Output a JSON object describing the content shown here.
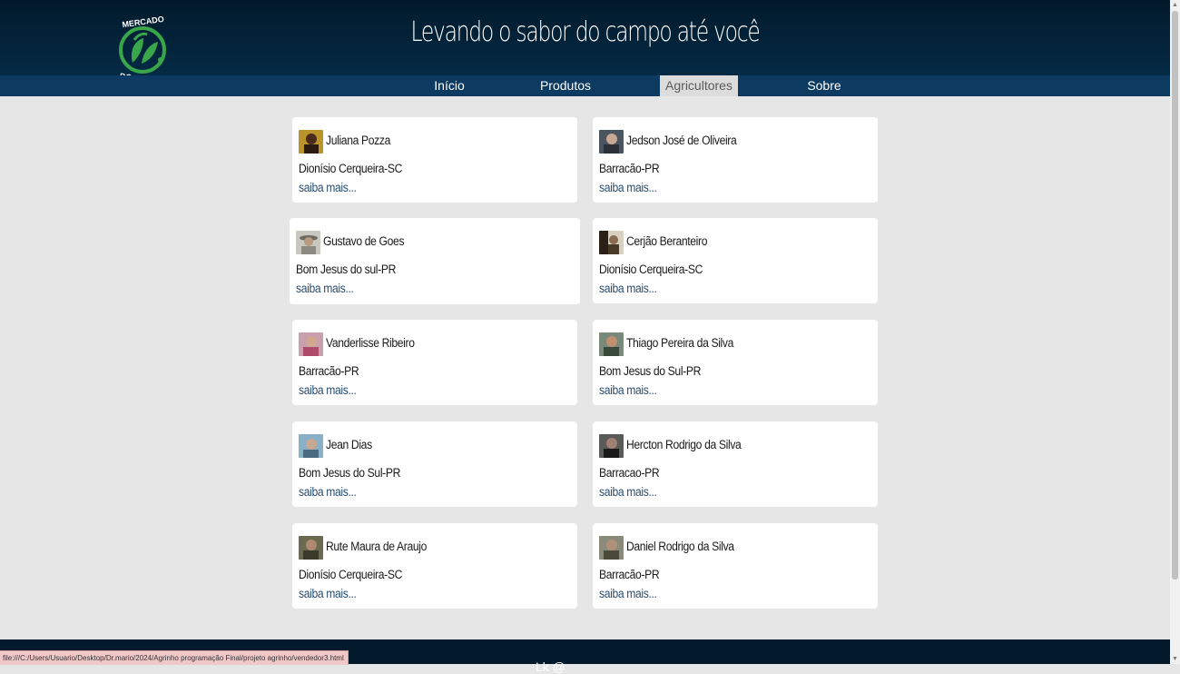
{
  "header": {
    "logo_top_text": "MERCADO",
    "logo_bottom_text": "DO CAMPO",
    "tagline": "Levando o sabor do campo até você"
  },
  "nav": [
    {
      "label": "Início",
      "active": false
    },
    {
      "label": "Produtos",
      "active": false
    },
    {
      "label": "Agricultores",
      "active": true
    },
    {
      "label": "Sobre",
      "active": false
    }
  ],
  "farmers": [
    {
      "name": "Juliana Pozza",
      "city": "Dionísio Cerqueira-SC",
      "more": "saiba mais...",
      "avatar_color": "#b8942a"
    },
    {
      "name": "Jedson José de Oliveira",
      "city": "Barracão-PR",
      "more": "saiba mais...",
      "avatar_color": "#4a5560"
    },
    {
      "name": "Gustavo de Goes",
      "city": "Bom Jesus do sul-PR",
      "more": "saiba mais...",
      "avatar_color": "#8c8c80"
    },
    {
      "name": "Cerjão Beranteiro",
      "city": "Dionísio Cerqueira-SC",
      "more": "saiba mais...",
      "avatar_color": "#5a4a30"
    },
    {
      "name": "Vanderlisse Ribeiro",
      "city": "Barracão-PR",
      "more": "saiba mais...",
      "avatar_color": "#b06a80"
    },
    {
      "name": "Thiago Pereira da Silva",
      "city": "Bom Jesus do Sul-PR",
      "more": "saiba mais...",
      "avatar_color": "#5a6a5a"
    },
    {
      "name": "Jean Dias",
      "city": "Bom Jesus do Sul-PR",
      "more": "saiba mais...",
      "avatar_color": "#6a8aa0"
    },
    {
      "name": "Hercton Rodrigo da Silva",
      "city": "Barracao-PR",
      "more": "saiba mais...",
      "avatar_color": "#3a3a3a"
    },
    {
      "name": "Rute Maura de Araujo",
      "city": "Dionísio Cerqueira-SC",
      "more": "saiba mais...",
      "avatar_color": "#4a4a3a"
    },
    {
      "name": "Daniel Rodrigo da Silva",
      "city": "Barracão-PR",
      "more": "saiba mais...",
      "avatar_color": "#6a6a5a"
    }
  ],
  "footer": {
    "text": "Lk    @"
  },
  "status_bar": "file:///C:/Users/Usuario/Desktop/Dr.mario/2024/Agrinho programação Final/projeto agrinho/vendedor3.html",
  "colors": {
    "header_dark": "#021a2b",
    "nav_bar": "#0c3a60",
    "link": "#2b4f74",
    "logo_green": "#3aa64a"
  }
}
